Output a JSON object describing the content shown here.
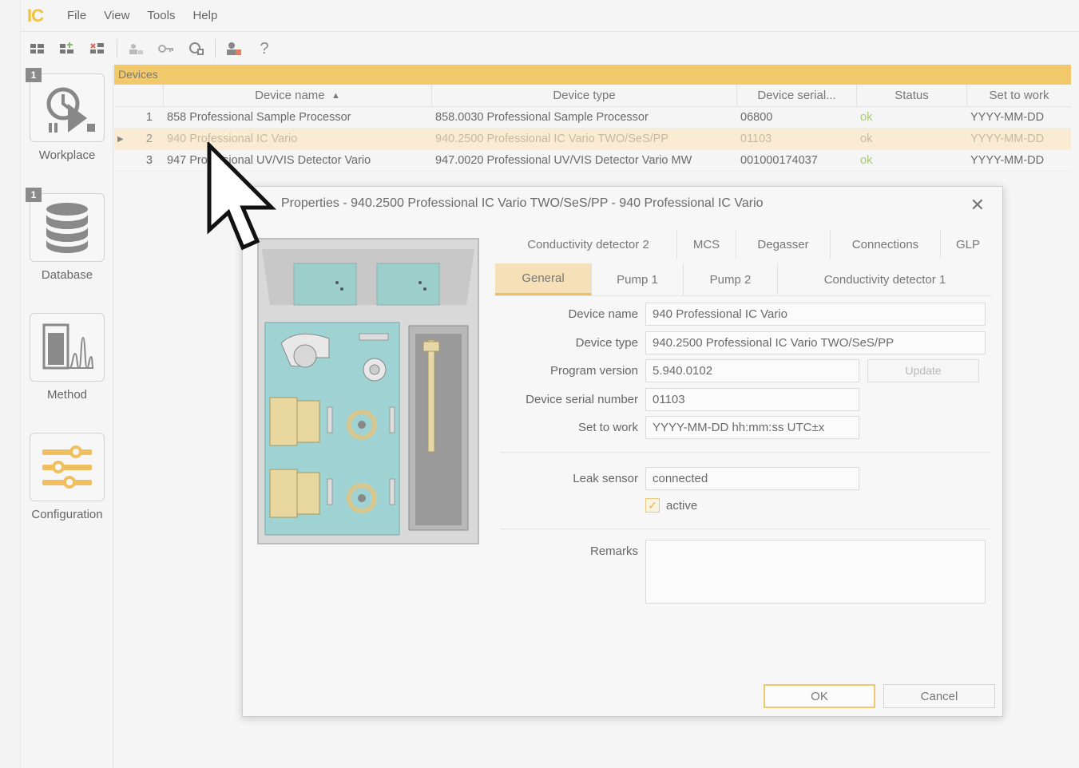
{
  "app": {
    "logo": "IC",
    "menu": [
      "File",
      "View",
      "Tools",
      "Help"
    ],
    "toolbar_help": "?"
  },
  "nav": {
    "items": [
      {
        "label": "Workplace",
        "badge": "1"
      },
      {
        "label": "Database",
        "badge": "1"
      },
      {
        "label": "Method",
        "badge": ""
      },
      {
        "label": "Configuration",
        "badge": ""
      }
    ]
  },
  "devices": {
    "title": "Devices",
    "columns": [
      "Device name",
      "Device type",
      "Device serial...",
      "Status",
      "Set to work"
    ],
    "sort_indicator": "▲",
    "rows": [
      {
        "num": "1",
        "name": "858 Professional Sample Processor",
        "type": "858.0030 Professional Sample Processor",
        "serial": "06800",
        "status": "ok",
        "set_to_work": "YYYY-MM-DD"
      },
      {
        "num": "2",
        "name": "940 Professional IC Vario",
        "type": "940.2500 Professional IC Vario TWO/SeS/PP",
        "serial": "01103",
        "status": "ok",
        "set_to_work": "YYYY-MM-DD"
      },
      {
        "num": "3",
        "name": "947 Professional UV/VIS Detector Vario",
        "type": "947.0020 Professional UV/VIS Detector Vario MW",
        "serial": "001000174037",
        "status": "ok",
        "set_to_work": "YYYY-MM-DD"
      }
    ]
  },
  "dialog": {
    "title": "Properties - 940.2500 Professional IC Vario TWO/SeS/PP - 940 Professional IC Vario",
    "tabs_row1": [
      "Conductivity detector 2",
      "MCS",
      "Degasser",
      "Connections",
      "GLP"
    ],
    "tabs_row2": [
      "General",
      "Pump 1",
      "Pump 2",
      "Conductivity detector 1"
    ],
    "active_tab": "General",
    "fields": {
      "device_name": {
        "label": "Device name",
        "value": "940 Professional IC Vario"
      },
      "device_type": {
        "label": "Device type",
        "value": "940.2500 Professional IC Vario TWO/SeS/PP"
      },
      "program_version": {
        "label": "Program version",
        "value": "5.940.0102"
      },
      "serial": {
        "label": "Device serial number",
        "value": "01103"
      },
      "set_to_work": {
        "label": "Set to work",
        "value": "YYYY-MM-DD hh:mm:ss UTC±x"
      },
      "leak_sensor": {
        "label": "Leak sensor",
        "value": "connected"
      },
      "active": {
        "label": "active",
        "checked": true
      },
      "remarks": {
        "label": "Remarks",
        "value": ""
      }
    },
    "update_label": "Update",
    "ok_label": "OK",
    "cancel_label": "Cancel"
  },
  "colors": {
    "accent": "#f1c86a",
    "selected_row": "#faecd2",
    "ok_status": "#a8c878",
    "instrument_body": "#9fd3d3"
  }
}
